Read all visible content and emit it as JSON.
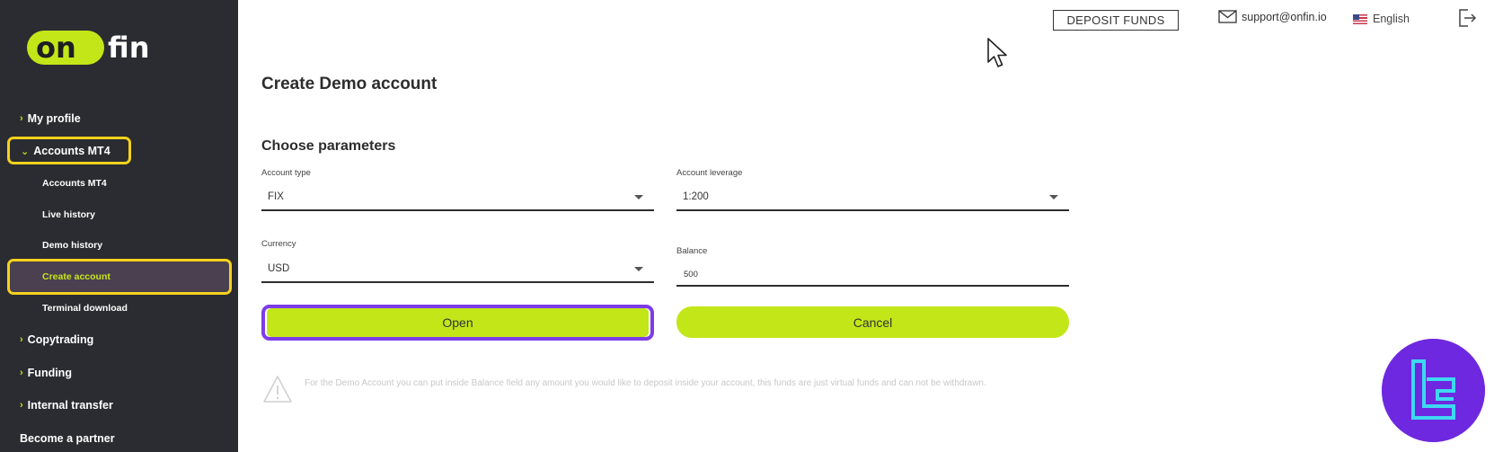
{
  "brand": {
    "logo_text_left": "on",
    "logo_text_right": "fin",
    "accent_color": "#c3e619",
    "sidebar_bg": "#2b2c31"
  },
  "header": {
    "deposit_label": "DEPOSIT FUNDS",
    "support_email": "support@onfin.io",
    "language": "English",
    "icons": {
      "mail": "mail-icon",
      "flag": "us-flag-icon",
      "logout": "logout-icon"
    }
  },
  "sidebar": {
    "items": [
      {
        "label": "My profile"
      },
      {
        "label": "Accounts MT4",
        "expanded": true,
        "children": [
          {
            "label": "Accounts MT4"
          },
          {
            "label": "Live history"
          },
          {
            "label": "Demo history"
          },
          {
            "label": "Create account",
            "active": true
          },
          {
            "label": "Terminal download"
          }
        ]
      },
      {
        "label": "Copytrading"
      },
      {
        "label": "Funding"
      },
      {
        "label": "Internal transfer"
      },
      {
        "label": "Become a partner"
      }
    ]
  },
  "main": {
    "title": "Create Demo account",
    "section_title": "Choose parameters",
    "fields": {
      "account_type": {
        "label": "Account type",
        "value": "FIX"
      },
      "account_leverage": {
        "label": "Account leverage",
        "value": "1:200"
      },
      "currency": {
        "label": "Currency",
        "value": "USD"
      },
      "balance": {
        "label": "Balance",
        "value": "500"
      }
    },
    "buttons": {
      "open": "Open",
      "cancel": "Cancel"
    },
    "notice": "For the Demo Account you can put inside Balance field any amount you would like to deposit inside your account, this funds are just virtual funds and can not be withdrawn."
  }
}
